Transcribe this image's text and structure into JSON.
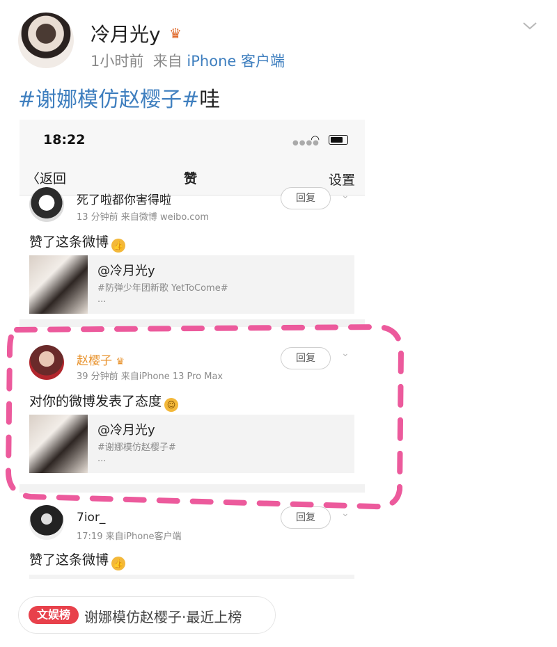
{
  "post": {
    "username": "冷月光y",
    "time": "1小时前",
    "source_prefix": "来自",
    "source": "iPhone 客户端",
    "text_tag": "#谢娜模仿赵樱子#",
    "text_rest": "哇"
  },
  "screenshot": {
    "status_time": "18:22",
    "back_label": "〈返回",
    "title": "赞",
    "settings_label": "设置",
    "cards": [
      {
        "name": "死了啦都你害得啦",
        "meta": "13 分钟前  来自微博 weibo.com",
        "reply_label": "回复",
        "text": "赞了这条微博",
        "quote_user": "@冷月光y",
        "quote_tag": "#防弹少年团新歌 YetToCome#",
        "quote_more": "..."
      },
      {
        "name": "赵樱子",
        "meta": "39 分钟前  来自iPhone 13 Pro Max",
        "reply_label": "回复",
        "text": "对你的微博发表了态度",
        "quote_user": "@冷月光y",
        "quote_tag": "#谢娜模仿赵樱子#",
        "quote_more": "..."
      },
      {
        "name": "7ior_",
        "meta": "17:19  来自iPhone客户端",
        "reply_label": "回复",
        "text": "赞了这条微博"
      }
    ]
  },
  "bottom_pill": {
    "badge": "文娱榜",
    "text": "谢娜模仿赵樱子·最近上榜"
  },
  "colors": {
    "link_blue": "#3f7fbf",
    "highlight_pink": "#ec5a9c",
    "badge_red": "#e8414b",
    "vip_orange": "#e8922c"
  }
}
